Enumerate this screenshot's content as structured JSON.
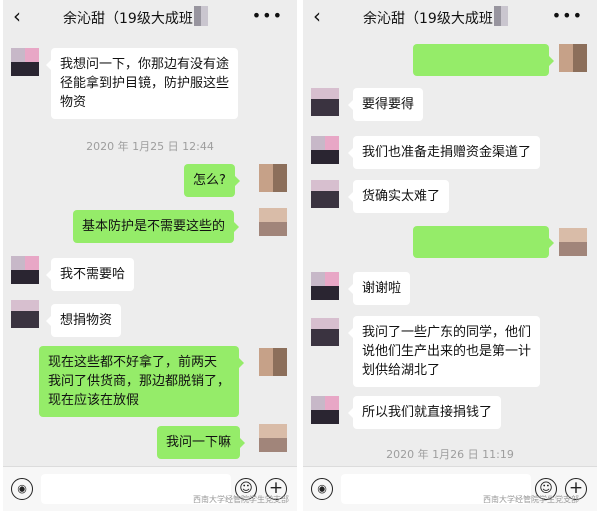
{
  "contact_title": "余沁甜（19级大成班",
  "watermark_text": "西南大学经管院学生党支部",
  "left": {
    "messages": [
      {
        "from": "them",
        "text": "我想问一下，你那边有没有途\n径能拿到护目镜，防护服这些\n物资"
      },
      {
        "type": "time",
        "text": "2020 年 1月25 日 12:44"
      },
      {
        "from": "me",
        "text": "怎么?"
      },
      {
        "from": "me",
        "text": "基本防护是不需要这些的"
      },
      {
        "from": "them",
        "text": "我不需要哈"
      },
      {
        "from": "them",
        "text": "想捐物资"
      },
      {
        "from": "me",
        "text": "现在这些都不好拿了，前两天\n我问了供货商，那边都脱销了，\n现在应该在放假"
      },
      {
        "from": "me",
        "text": "我问一下嘛"
      }
    ]
  },
  "right": {
    "messages": [
      {
        "from": "me",
        "text": ""
      },
      {
        "from": "them",
        "text": "要得要得"
      },
      {
        "from": "them",
        "text": "我们也准备走捐赠资金渠道了"
      },
      {
        "from": "them",
        "text": "货确实太难了"
      },
      {
        "from": "me",
        "text": ""
      },
      {
        "from": "them",
        "text": "谢谢啦"
      },
      {
        "from": "them",
        "text": "我问了一些广东的同学，他们\n说他们生产出来的也是第一计\n划供给湖北了"
      },
      {
        "from": "them",
        "text": "所以我们就直接捐钱了"
      },
      {
        "type": "time",
        "text": "2020 年 1月26 日 11:19"
      }
    ]
  },
  "colors": {
    "chat_bg": "#ededed",
    "bubble_out": "#95ec69",
    "bubble_in": "#ffffff"
  },
  "icons": {
    "back": "chevron-left-icon",
    "more": "more-dots-icon",
    "voice": "voice-icon",
    "emoji": "emoji-icon",
    "plus": "plus-icon"
  }
}
